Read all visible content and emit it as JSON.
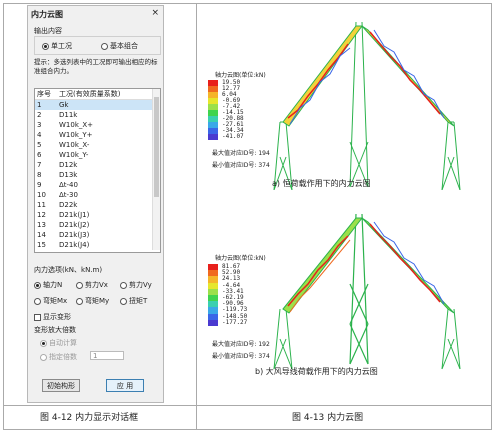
{
  "dialog": {
    "title": "内力云图",
    "close": "×",
    "output_label": "输出内容",
    "output_options": [
      "单工况",
      "基本组合"
    ],
    "hint": "提示：多选列表中的工况即可输出相应的标准组合内力。",
    "list_headers": [
      "序号",
      "工况(有效质量系数)"
    ],
    "rows": [
      [
        "1",
        "Gk"
      ],
      [
        "2",
        "D11k"
      ],
      [
        "3",
        "W10k_X+"
      ],
      [
        "4",
        "W10k_Y+"
      ],
      [
        "5",
        "W10k_X-"
      ],
      [
        "6",
        "W10k_Y-"
      ],
      [
        "7",
        "D12k"
      ],
      [
        "8",
        "D13k"
      ],
      [
        "9",
        "Δt-40"
      ],
      [
        "10",
        "Δt-30"
      ],
      [
        "11",
        "D22k"
      ],
      [
        "12",
        "D21k(J1)"
      ],
      [
        "13",
        "D21k(J2)"
      ],
      [
        "14",
        "D21k(J3)"
      ],
      [
        "15",
        "D21k(J4)"
      ]
    ],
    "force_label": "内力选项(kN、kN.m)",
    "force_options": [
      "轴力N",
      "剪力Vx",
      "剪力Vy",
      "弯矩Mx",
      "弯矩My",
      "扭矩T"
    ],
    "show_deform": "显示变形",
    "deform_label": "变形放大倍数",
    "auto_calc": "自动计算",
    "specify": "指定倍数",
    "specify_value": "1",
    "btn_initial": "初始构形",
    "btn_apply": "应 用"
  },
  "figure_a": {
    "legend_title": "轴力云图(单位:kN)",
    "values": [
      "19.50",
      "12.77",
      "6.04",
      "-0.69",
      "-7.42",
      "-14.15",
      "-20.88",
      "-27.61",
      "-34.34",
      "-41.07"
    ],
    "max_text": "最大值对应ID号: 194",
    "min_text": "最小值对应ID号: 374",
    "subcaption": "a)  恒荷载作用下的内力云图"
  },
  "figure_b": {
    "legend_title": "轴力云图(单位:kN)",
    "values": [
      "81.67",
      "52.90",
      "24.13",
      "-4.64",
      "-33.41",
      "-62.19",
      "-90.96",
      "-119.73",
      "-148.50",
      "-177.27"
    ],
    "max_text": "最大值对应ID号: 192",
    "min_text": "最小值对应ID号: 374",
    "subcaption": "b)  大风导线荷载作用下的内力云图"
  },
  "captions": {
    "left": "图 4-12    内力显示对话框",
    "right": "图 4-13    内力云图"
  },
  "colors": {
    "legend": [
      "#e8201c",
      "#f06a20",
      "#f5b52a",
      "#e6e62c",
      "#9be04a",
      "#3fd44e",
      "#3ad0b0",
      "#3aa8e8",
      "#3a66e8",
      "#4a3ad0"
    ]
  }
}
